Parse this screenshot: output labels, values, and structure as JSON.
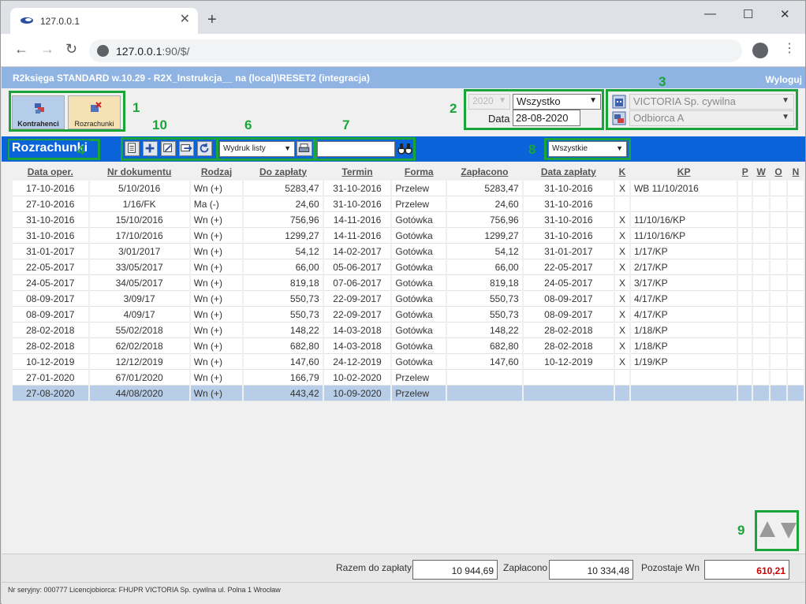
{
  "browser": {
    "tab_title": "127.0.0.1",
    "tab_close": "✕",
    "new_tab": "+",
    "url_host": "127.0.0.1",
    "url_path": ":90/$/",
    "back": "←",
    "forward": "→",
    "reload": "↻",
    "minimize": "—",
    "maximize": "☐",
    "close": "✕",
    "menu": "⋮"
  },
  "app": {
    "title": "R2księga STANDARD w.10.29 - R2X_Instrukcja__ na (local)\\RESET2 (integracja)",
    "logout": "Wyloguj"
  },
  "modules": {
    "kontrahenci": "Kontrahenci",
    "rozrachunki": "Rozrachunki"
  },
  "period": {
    "year": "2020",
    "range": "Wszystko",
    "date_label": "Data",
    "date": "28-08-2020"
  },
  "party": {
    "company": "VICTORIA Sp. cywilna",
    "recipient": "Odbiorca A"
  },
  "section_title": "Rozrachunki",
  "toolbar": {
    "print_option": "Wydruk listy",
    "search_value": "",
    "filter_option": "Wszystkie"
  },
  "annotations": [
    "1",
    "2",
    "3",
    "4",
    "6",
    "7",
    "8",
    "9",
    "10"
  ],
  "table": {
    "headers": [
      "Data oper.",
      "Nr dokumentu",
      "Rodzaj",
      "Do zapłaty",
      "Termin",
      "Forma",
      "Zapłacono",
      "Data zapłaty",
      "K",
      "KP",
      "P",
      "W",
      "O",
      "N"
    ],
    "rows": [
      [
        "17-10-2016",
        "5/10/2016",
        "Wn (+)",
        "5283,47",
        "31-10-2016",
        "Przelew",
        "5283,47",
        "31-10-2016",
        "X",
        "WB 11/10/2016",
        "",
        "",
        "",
        ""
      ],
      [
        "27-10-2016",
        "1/16/FK",
        "Ma (-)",
        "24,60",
        "31-10-2016",
        "Przelew",
        "24,60",
        "31-10-2016",
        "",
        "",
        "",
        "",
        "",
        ""
      ],
      [
        "31-10-2016",
        "15/10/2016",
        "Wn (+)",
        "756,96",
        "14-11-2016",
        "Gotówka",
        "756,96",
        "31-10-2016",
        "X",
        "11/10/16/KP",
        "",
        "",
        "",
        ""
      ],
      [
        "31-10-2016",
        "17/10/2016",
        "Wn (+)",
        "1299,27",
        "14-11-2016",
        "Gotówka",
        "1299,27",
        "31-10-2016",
        "X",
        "11/10/16/KP",
        "",
        "",
        "",
        ""
      ],
      [
        "31-01-2017",
        "3/01/2017",
        "Wn (+)",
        "54,12",
        "14-02-2017",
        "Gotówka",
        "54,12",
        "31-01-2017",
        "X",
        "1/17/KP",
        "",
        "",
        "",
        ""
      ],
      [
        "22-05-2017",
        "33/05/2017",
        "Wn (+)",
        "66,00",
        "05-06-2017",
        "Gotówka",
        "66,00",
        "22-05-2017",
        "X",
        "2/17/KP",
        "",
        "",
        "",
        ""
      ],
      [
        "24-05-2017",
        "34/05/2017",
        "Wn (+)",
        "819,18",
        "07-06-2017",
        "Gotówka",
        "819,18",
        "24-05-2017",
        "X",
        "3/17/KP",
        "",
        "",
        "",
        ""
      ],
      [
        "08-09-2017",
        "3/09/17",
        "Wn (+)",
        "550,73",
        "22-09-2017",
        "Gotówka",
        "550,73",
        "08-09-2017",
        "X",
        "4/17/KP",
        "",
        "",
        "",
        ""
      ],
      [
        "08-09-2017",
        "4/09/17",
        "Wn (+)",
        "550,73",
        "22-09-2017",
        "Gotówka",
        "550,73",
        "08-09-2017",
        "X",
        "4/17/KP",
        "",
        "",
        "",
        ""
      ],
      [
        "28-02-2018",
        "55/02/2018",
        "Wn (+)",
        "148,22",
        "14-03-2018",
        "Gotówka",
        "148,22",
        "28-02-2018",
        "X",
        "1/18/KP",
        "",
        "",
        "",
        ""
      ],
      [
        "28-02-2018",
        "62/02/2018",
        "Wn (+)",
        "682,80",
        "14-03-2018",
        "Gotówka",
        "682,80",
        "28-02-2018",
        "X",
        "1/18/KP",
        "",
        "",
        "",
        ""
      ],
      [
        "10-12-2019",
        "12/12/2019",
        "Wn (+)",
        "147,60",
        "24-12-2019",
        "Gotówka",
        "147,60",
        "10-12-2019",
        "X",
        "1/19/KP",
        "",
        "",
        "",
        ""
      ],
      [
        "27-01-2020",
        "67/01/2020",
        "Wn (+)",
        "166,79",
        "10-02-2020",
        "Przelew",
        "",
        "",
        "",
        "",
        "",
        "",
        "",
        ""
      ],
      [
        "27-08-2020",
        "44/08/2020",
        "Wn (+)",
        "443,42",
        "10-09-2020",
        "Przelew",
        "",
        "",
        "",
        "",
        "",
        "",
        "",
        ""
      ]
    ],
    "selected_row": 13
  },
  "totals": {
    "due_label": "Razem do zapłaty",
    "due_value": "10 944,69",
    "paid_label": "Zapłacono",
    "paid_value": "10 334,48",
    "remaining_label": "Pozostaje Wn",
    "remaining_value": "610,21",
    "remaining_color": "#cc0000"
  },
  "status": "Nr seryjny: 000777 Licencjobiorca: FHUPR VICTORIA Sp. cywilna ul. Polna 1 Wrocław",
  "colors": {
    "header_bar": "#8fb3e3",
    "section_bar": "#0a63d8",
    "annotation_green": "#1aa539",
    "selected_row": "#b8cde8"
  }
}
